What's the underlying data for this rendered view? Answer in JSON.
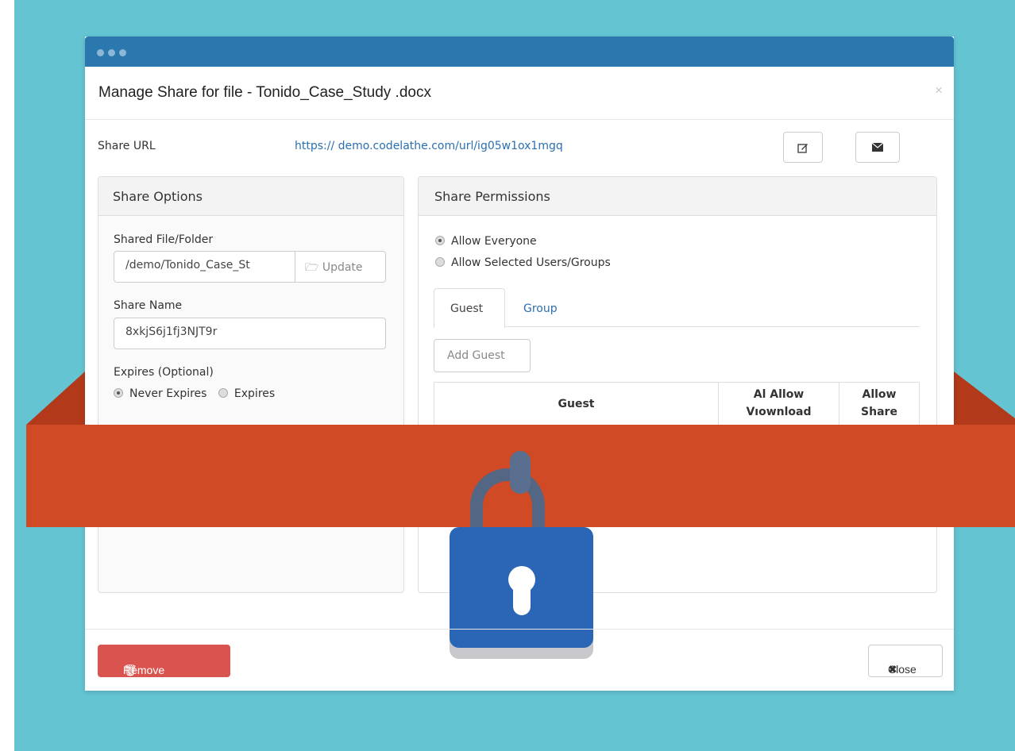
{
  "modal": {
    "title": "Manage Share for file - Tonido_Case_Study .docx",
    "close_x": "×"
  },
  "share_url": {
    "label": "Share URL",
    "value": "https:// demo.codelathe.com/url/ig05w1ox1mgq"
  },
  "share_options": {
    "title": "Share Options",
    "file_label": "Shared File/Folder",
    "file_value": "/demo/Tonido_Case_St",
    "update_label": "Update",
    "name_label": "Share Name",
    "name_value": "8xkjS6j1fj3NJT9r",
    "expires_label": "Expires (Optional)",
    "never_expires": "Never Expires",
    "expires": "Expires"
  },
  "share_permissions": {
    "title": "Share Permissions",
    "allow_everyone": "Allow Everyone",
    "allow_selected": "Allow Selected Users/Groups",
    "tabs": [
      "Guest",
      "Group"
    ],
    "add_guest": "Add Guest",
    "columns": [
      "Guest",
      "Al Allow\nVıownload",
      "Allow\nShare"
    ]
  },
  "footer": {
    "remove_share": "Remove Share",
    "close": "Close"
  },
  "colors": {
    "background": "#64c4d2",
    "titlebar": "#2a78ad",
    "ribbon": "#d04a25",
    "lock": "#2a65b6",
    "danger": "#d9534f"
  }
}
